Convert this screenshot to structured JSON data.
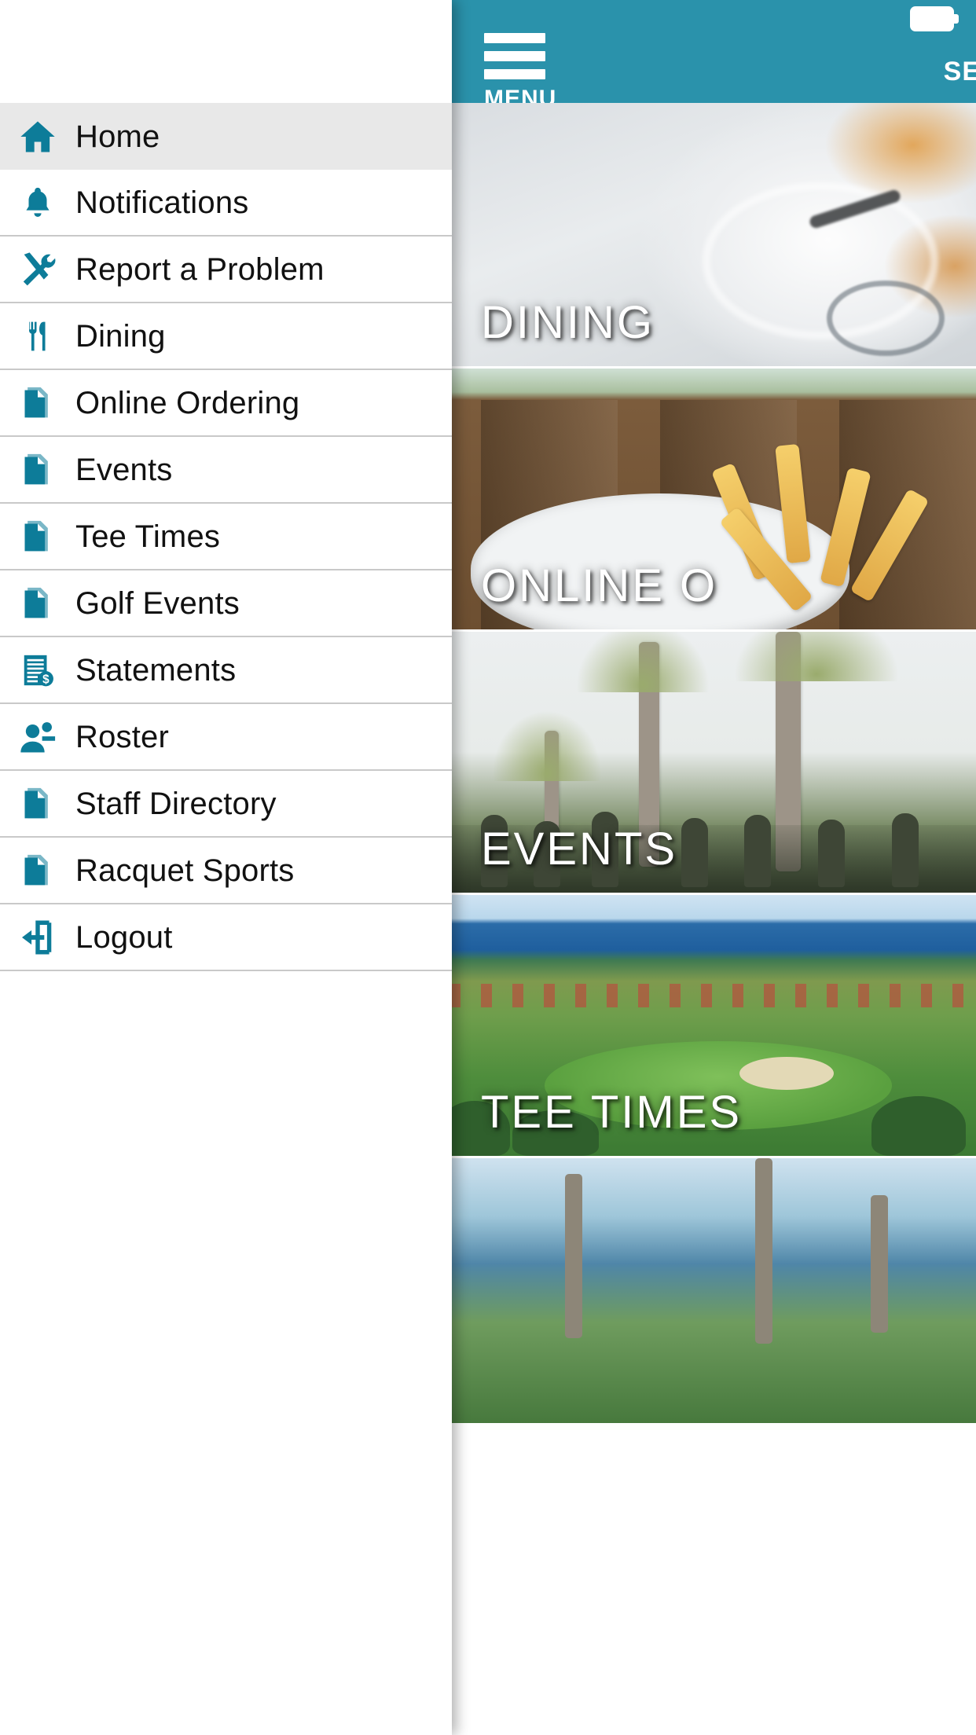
{
  "header": {
    "menu_label": "MENU",
    "search_label": "SE",
    "hamburger_icon": "hamburger-menu-icon",
    "battery_icon": "battery-full-icon",
    "background_color": "#2a92ab"
  },
  "drawer": {
    "accent_color": "#0d7c99",
    "active_item_background": "#e8e8e8",
    "items": [
      {
        "label": "Home",
        "icon": "home-icon",
        "active": true
      },
      {
        "label": "Notifications",
        "icon": "bell-icon",
        "active": false
      },
      {
        "label": "Report a Problem",
        "icon": "tools-icon",
        "active": false
      },
      {
        "label": "Dining",
        "icon": "fork-knife-icon",
        "active": false
      },
      {
        "label": "Online Ordering",
        "icon": "document-stack-icon",
        "active": false
      },
      {
        "label": "Events",
        "icon": "document-stack-icon",
        "active": false
      },
      {
        "label": "Tee Times",
        "icon": "document-stack-icon",
        "active": false
      },
      {
        "label": "Golf Events",
        "icon": "document-stack-icon",
        "active": false
      },
      {
        "label": "Statements",
        "icon": "invoice-dollar-icon",
        "active": false
      },
      {
        "label": "Roster",
        "icon": "people-group-icon",
        "active": false
      },
      {
        "label": "Staff Directory",
        "icon": "document-stack-icon",
        "active": false
      },
      {
        "label": "Racquet Sports",
        "icon": "document-stack-icon",
        "active": false
      },
      {
        "label": "Logout",
        "icon": "logout-arrow-icon",
        "active": false
      }
    ]
  },
  "tiles": [
    {
      "caption": "DINING",
      "photo": "plated-food-closeup"
    },
    {
      "caption": "ONLINE O",
      "photo": "french-fries-bowl-on-wood"
    },
    {
      "caption": "EVENTS",
      "photo": "palm-trees-outdoor-gathering"
    },
    {
      "caption": "TEE TIMES",
      "photo": "oceanside-golf-course"
    },
    {
      "caption": "",
      "photo": "coastal-palms-partial"
    }
  ]
}
